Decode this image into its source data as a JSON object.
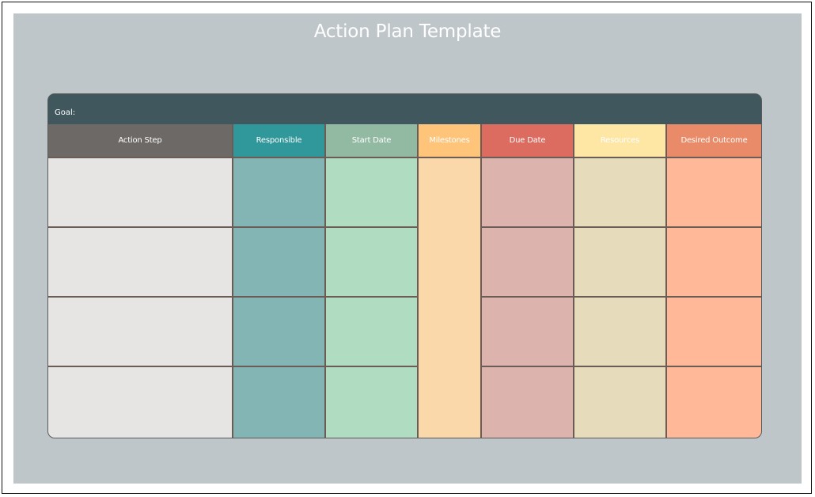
{
  "title": "Action Plan Template",
  "goal_label": "Goal:",
  "colors": {
    "canvas_background": "#bfc6ca",
    "goal_bar": "#3f575d",
    "grid_lines": "#6b5c56"
  },
  "columns": [
    {
      "key": "action_step",
      "label": "Action Step",
      "header_color": "#6d6967",
      "cell_color": "#e6e5e3"
    },
    {
      "key": "responsible",
      "label": "Responsible",
      "header_color": "#30979a",
      "cell_color": "#83b5b4"
    },
    {
      "key": "start_date",
      "label": "Start Date",
      "header_color": "#92baa2",
      "cell_color": "#b0ddc1"
    },
    {
      "key": "milestones",
      "label": "Milestones",
      "header_color": "#fec47a",
      "cell_color": "#fbd8aa",
      "merged_rows": true
    },
    {
      "key": "due_date",
      "label": "Due Date",
      "header_color": "#dc6c60",
      "cell_color": "#dcb4ad"
    },
    {
      "key": "resources",
      "label": "Resources",
      "header_color": "#fee6a5",
      "cell_color": "#e6dbba"
    },
    {
      "key": "desired_outcome",
      "label": "Desired Outcome",
      "header_color": "#e98b68",
      "cell_color": "#ffb999"
    }
  ],
  "rows": [
    {
      "action_step": "",
      "responsible": "",
      "start_date": "",
      "due_date": "",
      "resources": "",
      "desired_outcome": ""
    },
    {
      "action_step": "",
      "responsible": "",
      "start_date": "",
      "due_date": "",
      "resources": "",
      "desired_outcome": ""
    },
    {
      "action_step": "",
      "responsible": "",
      "start_date": "",
      "due_date": "",
      "resources": "",
      "desired_outcome": ""
    },
    {
      "action_step": "",
      "responsible": "",
      "start_date": "",
      "due_date": "",
      "resources": "",
      "desired_outcome": ""
    }
  ],
  "milestones_value": ""
}
